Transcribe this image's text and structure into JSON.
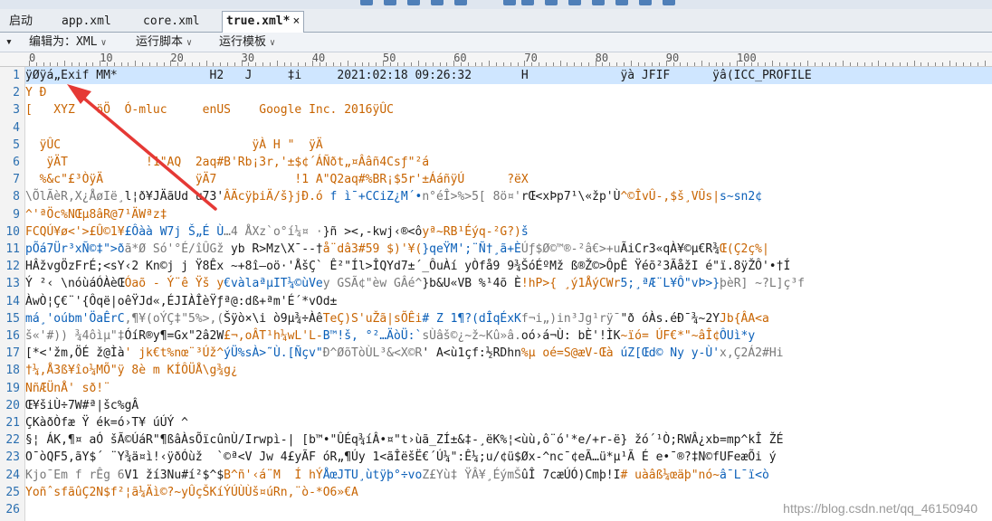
{
  "tabs": [
    {
      "label": "启动"
    },
    {
      "label": "app.xml"
    },
    {
      "label": "core.xml"
    },
    {
      "label": "true.xml*",
      "close": "×",
      "active": true
    }
  ],
  "toolbar": {
    "collapse_glyph": "▾",
    "editor_as_label": "编辑为：XML",
    "run_script_label": "运行脚本",
    "run_template_label": "运行模板",
    "dropdown_glyph": "∨"
  },
  "ruler": {
    "labels": [
      "0",
      "10",
      "20",
      "30",
      "40",
      "50",
      "60",
      "70",
      "80",
      "90",
      "100"
    ]
  },
  "line_numbers": [
    "1",
    "2",
    "3",
    "4",
    "5",
    "6",
    "7",
    "8",
    "9",
    "10",
    "11",
    "12",
    "13",
    "14",
    "15",
    "16",
    "17",
    "18",
    "19",
    "20",
    "21",
    "22",
    "23",
    "24",
    "25",
    "26"
  ],
  "lines": [
    [
      {
        "t": "ÿØÿá„Exif MM*             H2   J     ‡i     2021:02:18 09:26:32       H             ÿà JFIF      ÿâ(ICC_PROFILE",
        "c": "blk"
      }
    ],
    [
      {
        "t": "Y Ð",
        "c": "orn"
      }
    ],
    [
      {
        "t": "[   XYZ   öÖ  Ó-mluc     enUS    Google Inc. 2016ÿÛC",
        "c": "orn"
      }
    ],
    [
      {
        "t": "",
        "c": "blk"
      }
    ],
    [
      {
        "t": "  ÿÛC                           ÿÀ H \"  ÿÄ",
        "c": "orn"
      }
    ],
    [
      {
        "t": "   ÿÄT           !1\"AQ  2aq#B'Rb¡3r,'±$¢´ÁÑðt„¤Ââñ4Csƒ\"²á",
        "c": "orn"
      }
    ],
    [
      {
        "t": "  %&c\"£³ÒÿÄ             ÿÄ7           !1 A\"Q2aq#%BR¡$5r'±ÁáñÿÚ      ?ëX",
        "c": "orn"
      }
    ],
    [
      {
        "t": "\\ÕlÃèR,X¿ÅøIë¸l¦ð¥JÄãUd u73'ÂÄcÿþiÄ/š}jÐ.ó f ì¯+CCiZ¿M´•n°éÎ>%>5[ 8ö¤'rŒ<xÞp7¹\\«žp'Ù^©ÎvÛ-,$š¸VÛs|s~sn2¢",
        "c": "mix"
      }
    ],
    [
      {
        "t": "^'ªÖc%NŒµ8âR@7¹ÄWªz‡",
        "c": "orn"
      }
    ],
    [
      {
        "t": "FCQÚ¥ø<'>£Û©1¥£Ôàà W7j Š„É Ù…4 ÅXz`o°í¼¤ ·}ñ ><,-kwj‹®<ôyª~RB¹Éýq-²G?)š",
        "c": "mix"
      }
    ],
    [
      {
        "t": "pÕá7Ür³xÑ©‡\">ðã*Ø Só'°É/îÛGž yb R>Mz\\X¯--†å¨dâ3#59 $)'¥(}qeŸM';¨Ñ†¸ã+ÈÚƒ$Ø©™®-²â€>+uÃiCr3«qÀ¥©µ€R¾Œ(Ç2ç%|",
        "c": "mix"
      }
    ],
    [
      {
        "t": "HÂžvgÖzFrÉ;<sY‹2 Kn©j j Ÿ8Êx ~+8î—oö·'ÅšÇ` Ê²\"Íl>ÎQYd7±´_ÔuÀí yÒfå9 9¾ŠóÉºMž ß®Ž©>ÔpÊ Ÿéõ²3ÃåžI é\"ï.8ÿŽÔ'•†Í",
        "c": "blk"
      }
    ],
    [
      {
        "t": "Ý ²‹ \\nóùáÓÀèŒÓaõ - Ý¨ê Ÿš y€vàlaªµIT¼©ùVey GSÃ¢\"èw GÂé^}b&U«VB %¹4õ È!hP>{ ¸ý1ÅýCWr5;¸ªÆ¨L¥Ô\"vÞ>}þèR] ~?L]ç³f",
        "c": "mix"
      }
    ],
    [
      {
        "t": "ÀwÒ¦Ç€¨'{Ôqë|oêŸJd«,ÉJIÀÎèŸƒª@:dß+ªm'É´*vOd±",
        "c": "blk"
      }
    ],
    [
      {
        "t": "má¸'oúbm'ÖaÊrC,¶¥(oÝÇ‡\"5%>,(Šÿò×\\i ò9µ¾÷ÀêTeÇ)S'uŽã|sÕÊi# Z 1¶?(dÎqÉxKf¬i„)in³Jg¹rÿ¯\"ð óÀs.éÐ¯¾~2YJb{ÂA<a",
        "c": "mix"
      }
    ],
    [
      {
        "t": "š«'#)) ¾4ôìµ\"‡ÓíR®y¶=Gx\"2â2W£¬,oÂT¹h¼wL'L-B™!š, °²…ÄòÜ:`sÙâš©¿~ž~Kû»â.oó›á¬Ù: bÈ'!ÌK~ïó= ÚF€*\"~âÎ¢ÔUì*y",
        "c": "mix"
      }
    ],
    [
      {
        "t": "[*<'žm,ÖÉ ž@Ìà' jk€t%nœ¨³Úž^ýÜ%sÀ>˜Ù.[Ñçv\"Ð^ØõTòÙL³&<X©R' A<ù1çf:½RDhn%µ oé=S@æV-Œà úZ[Œd© Ny y-Ù'x,Ç2Á2#Hi",
        "c": "mix"
      }
    ],
    [
      {
        "t": "†¼,Å3ß¥îo¼MÕ\"ÿ 8è m KÍÔÜÅ\\g¾g¿",
        "c": "orn"
      }
    ],
    [
      {
        "t": "NñÆÜnÅ' sð!¨",
        "c": "orn"
      }
    ],
    [
      {
        "t": "Œ¥šiÙ÷7W#ª|šc%gÂ",
        "c": "blk"
      }
    ],
    [
      {
        "t": "ÇKàðÒfæ Ÿ ék=ó›T¥ úÚÝ ^",
        "c": "blk"
      }
    ],
    [
      {
        "t": "§¦ ÁK,¶¤ aÓ šÃ©ÚáR\"¶ßâÀsÕïcûnÙ/Irwpì-| [b™•\"ÛÉq¾íÂ•¤\"t›ùã_ZÍ±&‡-¸ëK%¦<ùù,ô¨ó'*e/+r-ë} žó´¹Ò;RWÂ¿xb=mp^kÎ ŽÉ",
        "c": "blk"
      }
    ],
    [
      {
        "t": "O¯òQF5,ãY$´ ¨Y¾ä¤ì!‹ÿðÓùž  `©ª<V Jw 4£yÃF óR„¶Úy 1<ãÎëšË€´Ú¼\":Ê¼;u/¢ü$Øx-^nc¯¢eÃ…ü*µ¹Ã É e•¯®?‡N©fUFeæÕi ý",
        "c": "blk"
      }
    ],
    [
      {
        "t": "Kjo¯Em f rÊg 6V1 ží3Nu#í²$^$B^ñ'‹á¨M  Í hÝÅœJTU¸ùtÿþ°÷voZ£Yù‡ ŸÂ¥¸ÉýmŠûÎ 7cæÚÓ)Cmþ!I# uàâß¼œäþ\"nó~â¯L¯ï<ò",
        "c": "mix"
      }
    ],
    [
      {
        "t": "YoñˆsfãûÇ2N$f²¦ã¼Äì©?~yÛçŠKíÝÚÙÙš¤úRn,¨ò-*O6»€A",
        "c": "orn"
      }
    ],
    [
      {
        "t": "",
        "c": "blk"
      }
    ]
  ],
  "watermark": "https://blog.csdn.net/qq_46150940",
  "colors": {
    "highlight_row": "#cfe6ff",
    "annotation_arrow": "#e53935",
    "line_number": "#2b6fb0"
  }
}
